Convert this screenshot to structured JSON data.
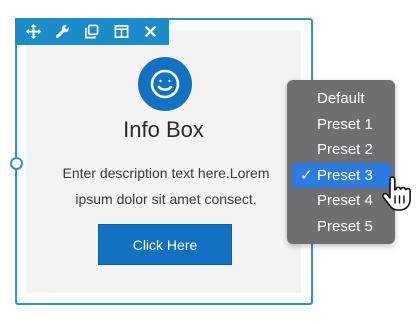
{
  "toolbar": {
    "icons": [
      "move-icon",
      "wrench-icon",
      "duplicate-icon",
      "columns-icon",
      "close-icon"
    ],
    "color": "#1b8ccb"
  },
  "widget": {
    "title": "Info Box",
    "description": "Enter description text here.Lorem ipsum dolor sit amet consect.",
    "button_label": "Click Here",
    "icon": "smiley-icon",
    "accent": "#1172c4"
  },
  "preset_menu": {
    "items": [
      "Default",
      "Preset 1",
      "Preset 2",
      "Preset 3",
      "Preset 4",
      "Preset 5"
    ],
    "selected": "Preset 3",
    "check_glyph": "✓",
    "background": "#6f6e70",
    "highlight": "#2b7be0"
  }
}
